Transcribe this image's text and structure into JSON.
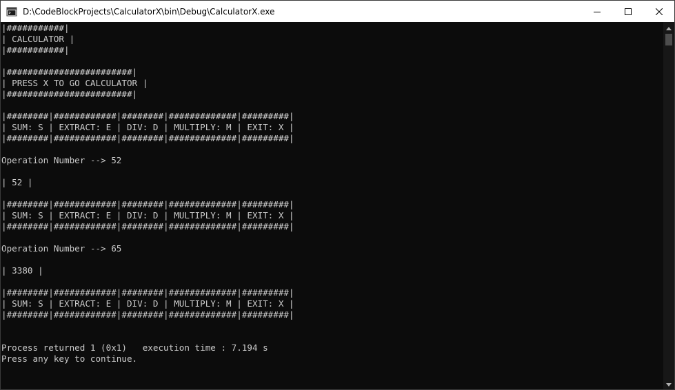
{
  "window": {
    "title": "D:\\CodeBlockProjects\\CalculatorX\\bin\\Debug\\CalculatorX.exe"
  },
  "icons": {
    "app": "console-app-icon",
    "minimize": "minimize-icon",
    "maximize": "maximize-icon",
    "close": "close-icon",
    "scroll_up": "scroll-up-arrow-icon",
    "scroll_down": "scroll-down-arrow-icon"
  },
  "colors": {
    "console_background": "#0c0c0c",
    "console_text": "#cccccc",
    "titlebar": "#ffffff"
  },
  "console": {
    "lines": [
      "|###########|",
      "| CALCULATOR |",
      "|###########|",
      "",
      "|########################|",
      "| PRESS X TO GO CALCULATOR |",
      "|########################|",
      "",
      "|########|############|########|#############|#########|",
      "| SUM: S | EXTRACT: E | DIV: D | MULTIPLY: M | EXIT: X |",
      "|########|############|########|#############|#########|",
      "",
      "Operation Number --> 52",
      "",
      "| 52 |",
      "",
      "|########|############|########|#############|#########|",
      "| SUM: S | EXTRACT: E | DIV: D | MULTIPLY: M | EXIT: X |",
      "|########|############|########|#############|#########|",
      "",
      "Operation Number --> 65",
      "",
      "| 3380 |",
      "",
      "|########|############|########|#############|#########|",
      "| SUM: S | EXTRACT: E | DIV: D | MULTIPLY: M | EXIT: X |",
      "|########|############|########|#############|#########|",
      "",
      "",
      "Process returned 1 (0x1)   execution time : 7.194 s",
      "Press any key to continue."
    ]
  }
}
